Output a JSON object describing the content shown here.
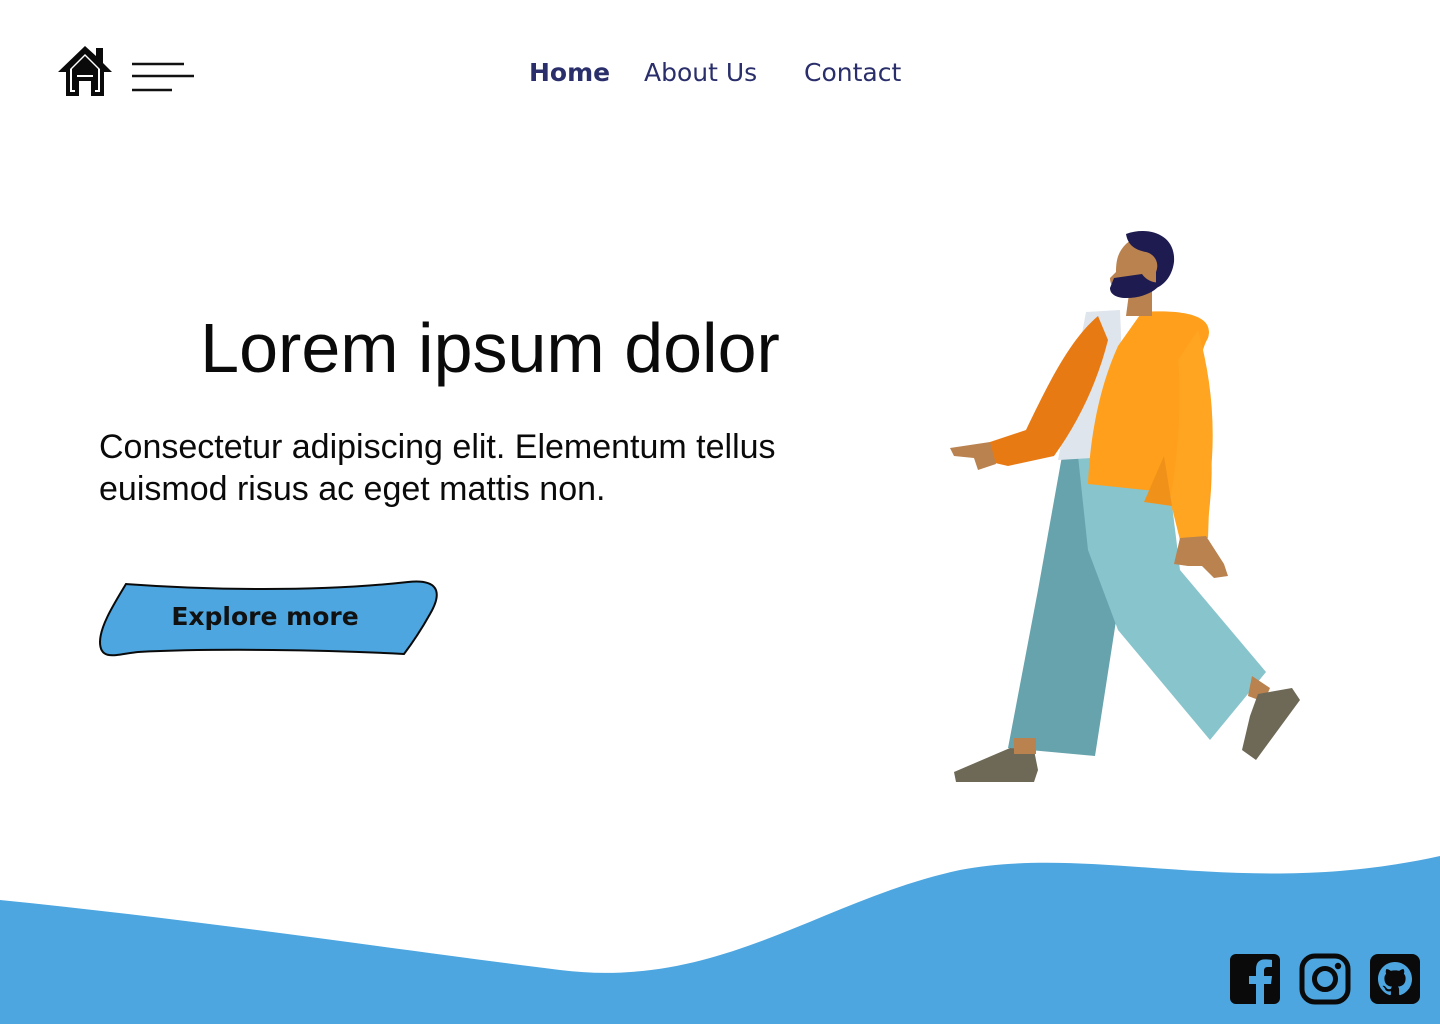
{
  "header": {
    "logo_icon": "home-icon",
    "menu_icon": "hamburger-menu-icon",
    "nav": [
      {
        "label": "Home",
        "active": true
      },
      {
        "label": "About Us",
        "active": false
      },
      {
        "label": "Contact",
        "active": false
      }
    ],
    "nav_color": "#2a2f6b"
  },
  "hero": {
    "title": "Lorem ipsum dolor",
    "subtitle": "Consectetur adipiscing elit. Elementum tellus euismod risus ac eget mattis non.",
    "cta_label": "Explore more",
    "cta_color": "#4da6e0"
  },
  "illustration": {
    "subject": "walking-person",
    "colors": {
      "jacket": "#ff9f1c",
      "jacket_shadow": "#e87a14",
      "pants": "#88c4cc",
      "pants_shadow": "#67a3ad",
      "skin": "#b9824f",
      "hair": "#1d1b4f",
      "shoes": "#6e6856",
      "shirt": "#dfe5ec"
    }
  },
  "footer": {
    "wave_color": "#4da6e0",
    "social": [
      {
        "icon": "facebook-icon"
      },
      {
        "icon": "instagram-icon"
      },
      {
        "icon": "github-icon"
      }
    ]
  }
}
